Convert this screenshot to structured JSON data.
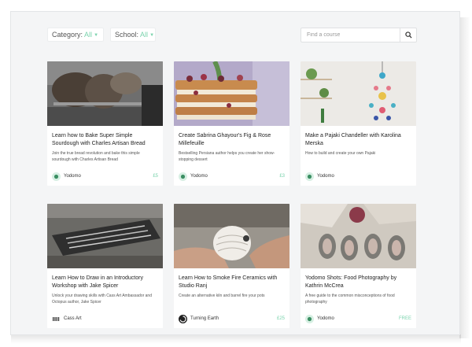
{
  "filters": {
    "category": {
      "label": "Category:",
      "value": "All"
    },
    "school": {
      "label": "School:",
      "value": "All"
    }
  },
  "search": {
    "placeholder": "Find a course"
  },
  "courses": [
    {
      "title": "Learn how to Bake Super Simple Sourdough with Charles Artisan Bread",
      "description": "Join the true bread revolution and bake this simple sourdough with Charles Artisan Bread",
      "provider": "Yodomo",
      "price": "£5",
      "icon": "yodomo-logo-icon"
    },
    {
      "title": "Create Sabrina Ghayour's Fig & Rose Millefeuille",
      "description": "Bestselling Persiana author helps you create her show-stopping dessert",
      "provider": "Yodomo",
      "price": "£3",
      "icon": "yodomo-logo-icon"
    },
    {
      "title": "Make a Pajaki Chandeller with Karolina Merska",
      "description": "How to build and create your own Pajaki",
      "provider": "Yodomo",
      "price": "",
      "icon": "yodomo-logo-icon"
    },
    {
      "title": "Learn How to Draw in an Introductory Workshop with Jake Spicer",
      "description": "Unlock your drawing skills with Cass Art Ambassador and Octopus author, Jake Spicer",
      "provider": "Cass Art",
      "price": "",
      "icon": "cass-art-logo-icon"
    },
    {
      "title": "Learn How to Smoke Fire Ceramics with Studio Ranj",
      "description": "Create an alternative kiln and barrel fire your pots",
      "provider": "Turning Earth",
      "price": "£25",
      "icon": "turning-earth-logo-icon"
    },
    {
      "title": "Yodomo Shots: Food Photography by Kathrin McCrea",
      "description": "A free guide to the common misconceptions of food photography",
      "provider": "Yodomo",
      "price": "FREE",
      "icon": "yodomo-logo-icon"
    }
  ],
  "colors": {
    "accent": "#7bd3ad",
    "background": "#f4f5f6",
    "card": "#ffffff"
  }
}
